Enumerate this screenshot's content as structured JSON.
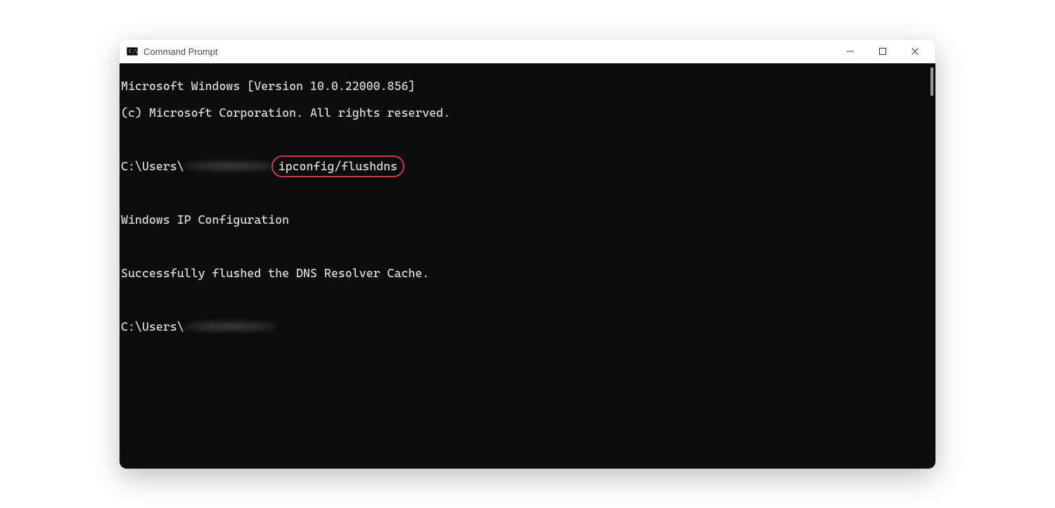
{
  "window": {
    "title": "Command Prompt"
  },
  "terminal": {
    "version_line": "Microsoft Windows [Version 10.0.22000.856]",
    "copyright_line": "(c) Microsoft Corporation. All rights reserved.",
    "prompt_prefix": "C:\\Users\\",
    "command": "ipconfig/flushdns",
    "output_header": "Windows IP Configuration",
    "output_message": "Successfully flushed the DNS Resolver Cache.",
    "prompt_prefix2": "C:\\Users\\"
  },
  "highlight": {
    "color": "#c33a4b"
  }
}
